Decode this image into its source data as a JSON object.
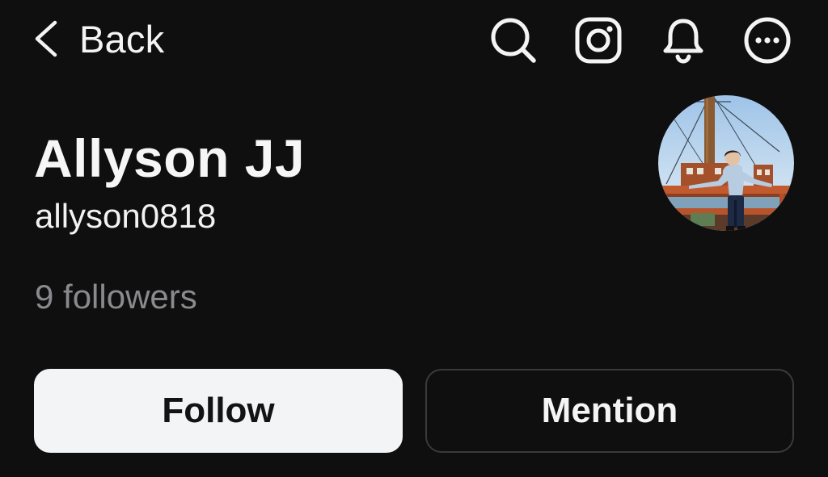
{
  "header": {
    "back_label": "Back",
    "icons": [
      "search-icon",
      "instagram-icon",
      "bell-icon",
      "more-icon"
    ]
  },
  "profile": {
    "display_name": "Allyson JJ",
    "username": "allyson0818",
    "followers_text": "9 followers",
    "avatar": "avatar-photo"
  },
  "actions": {
    "follow_label": "Follow",
    "mention_label": "Mention"
  },
  "colors": {
    "background": "#0f0f10",
    "text": "#f4f4f5",
    "muted": "#8a8a8e",
    "follow_bg": "#f3f4f6",
    "mention_border": "#3a3a3d"
  }
}
